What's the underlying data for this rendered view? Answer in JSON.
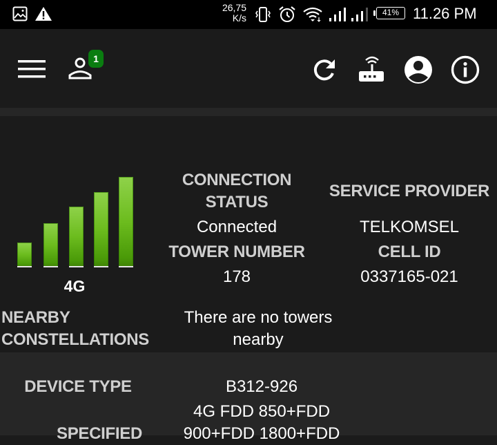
{
  "status_bar": {
    "icons_left": [
      "image-icon",
      "warning-icon"
    ],
    "network_speed": "26,75\nK/s",
    "network_speed_value": "26,75",
    "network_speed_unit": "K/s",
    "icons_right": [
      "vibrate-icon",
      "alarm-icon",
      "wifi-icon",
      "signal-sim1-icon",
      "signal-sim2-icon"
    ],
    "battery": "41%",
    "time": "11.26 PM"
  },
  "toolbar": {
    "left_icons": [
      "menu-icon",
      "user-icon"
    ],
    "user_badge": "1",
    "right_icons": [
      "refresh-icon",
      "router-icon",
      "account-icon",
      "info-icon"
    ],
    "badge_color": "#0a7d10"
  },
  "signal": {
    "network_type": "4G",
    "bars_total": 5,
    "bars_lit": 5,
    "bar_color": "#6cbc1e"
  },
  "info": {
    "connection_status_label": "CONNECTION STATUS",
    "connection_status_line1": "CONNECTION",
    "connection_status_line2": "STATUS",
    "connection_status_value": "Connected",
    "service_provider_label": "SERVICE PROVIDER",
    "service_provider_value": "TELKOMSEL",
    "tower_number_label": "TOWER NUMBER",
    "tower_number_value": "178",
    "cell_id_label": "CELL ID",
    "cell_id_value": "0337165-021",
    "nearby_label_line1": "NEARBY",
    "nearby_label_line2": "CONSTELLATIONS",
    "nearby_value_line1": "There are no towers",
    "nearby_value_line2": "nearby"
  },
  "device": {
    "device_type_label": "DEVICE TYPE",
    "device_type_value": "B312-926",
    "specified_label": "SPECIFIED",
    "specified_value_line1": "4G FDD 850+FDD",
    "specified_value_line2": "900+FDD 1800+FDD"
  }
}
